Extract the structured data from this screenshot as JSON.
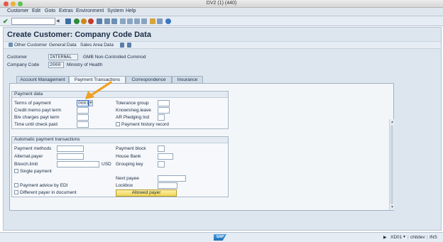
{
  "window": {
    "title": "DV2 (1) (440)"
  },
  "menu": [
    "Customer",
    "Edit",
    "Goto",
    "Extras",
    "Environment",
    "System",
    "Help"
  ],
  "screen": {
    "title": "Create Customer: Company Code Data"
  },
  "app_toolbar": {
    "other_customer": "Other Customer",
    "general_data": "General Data",
    "sales_area_data": "Sales Area Data"
  },
  "header": {
    "customer_label": "Customer",
    "customer_value": "INTERNAL",
    "customer_desc": "GMB Non-Controlled Commod",
    "company_code_label": "Company Code",
    "company_code_value": "2000",
    "company_code_desc": "Ministry of Health"
  },
  "tabs": [
    "Account Management",
    "Payment Transactions",
    "Correspondence",
    "Insurance"
  ],
  "active_tab": "Payment Transactions",
  "payment_data": {
    "title": "Payment data",
    "terms_label": "Terms of payment",
    "terms_value": "0001",
    "credit_memo_label": "Credit memo payt term",
    "be_charges_label": "B/e charges payt term",
    "time_until_label": "Time until check paid",
    "tolerance_label": "Tolerance group",
    "known_neg_label": "Known/neg.leave",
    "ar_pledging_label": "AR Pledging Ind",
    "payment_history_label": "Payment history record"
  },
  "auto_payment": {
    "title": "Automatic payment transactions",
    "payment_methods_label": "Payment methods",
    "alternat_payer_label": "Alternat.payer",
    "be_exch_limit_label": "B/exch.limit",
    "currency": "USD",
    "single_payment_label": "Single payment",
    "payment_block_label": "Payment block",
    "house_bank_label": "House Bank",
    "grouping_key_label": "Grouping key",
    "next_payee_label": "Next payee",
    "payment_advice_label": "Payment advice by EDI",
    "lockbox_label": "Lockbox",
    "different_payer_label": "Different payer in document",
    "allowed_payer_button": "Allowed payer"
  },
  "status": {
    "logo": "SAP",
    "transaction": "XD01",
    "server": "chitdev",
    "mode": "INS"
  },
  "colors": {
    "accent": "#f0a020",
    "panel": "#dde6ef",
    "button": "#f0d55a"
  }
}
